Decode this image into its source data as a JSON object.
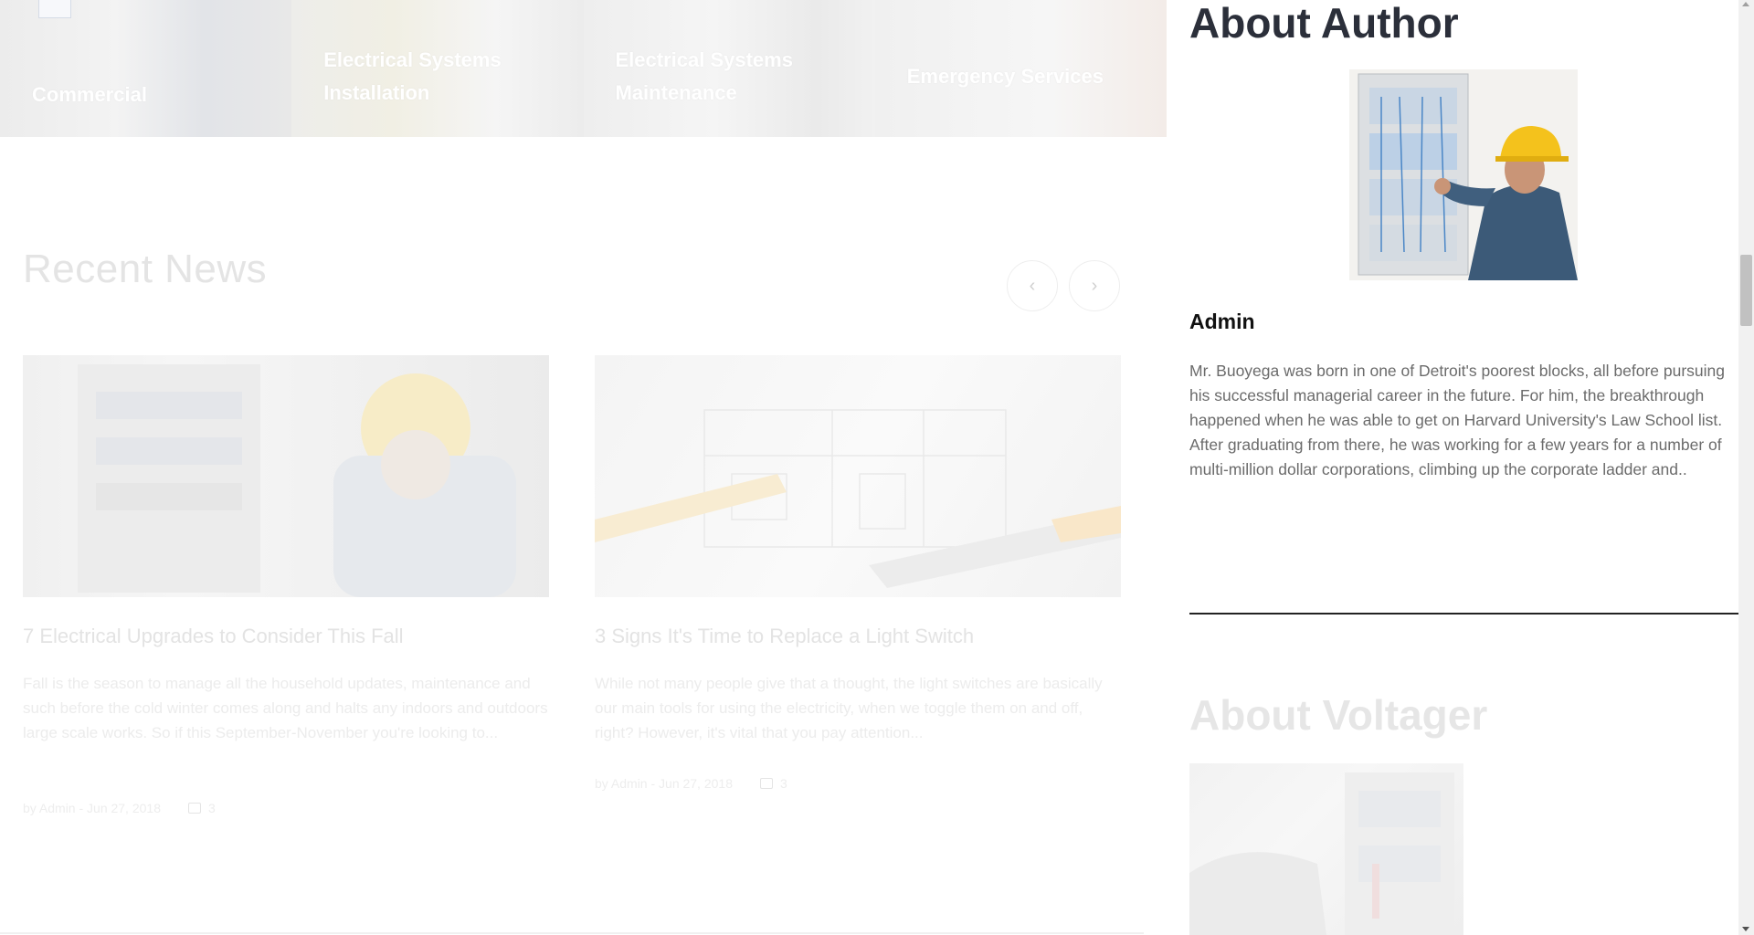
{
  "services": {
    "items": [
      {
        "label": "Commercial"
      },
      {
        "label": "Electrical Systems Installation"
      },
      {
        "label": "Electrical Systems Maintenance"
      },
      {
        "label": "Emergency Services"
      }
    ]
  },
  "news": {
    "title": "Recent News",
    "prev_icon": "chevron-left-icon",
    "next_icon": "chevron-right-icon",
    "posts": [
      {
        "title": "7 Electrical Upgrades to Consider This Fall",
        "excerpt": "Fall is the season to manage all the household updates, maintenance and such before the cold winter comes along and halts any indoors and outdoors large scale works. So if this September-November you're looking to...",
        "meta": "by Admin - Jun 27, 2018",
        "comments": "3"
      },
      {
        "title": "3 Signs It's Time to Replace a Light Switch",
        "excerpt": "While not many people give that a thought, the light switches are basically our main tools for using the electricity, when we toggle them on and off, right? However, it's vital that you pay attention...",
        "meta": "by Admin - Jun 27, 2018",
        "comments": "3"
      }
    ]
  },
  "sidebar": {
    "about_author_title": "About Author",
    "author_name": "Admin",
    "author_bio": "Mr. Buoyega was born in one of Detroit's poorest blocks, all before pursuing his successful managerial career in the future. For him, the breakthrough happened when he was able to get on Harvard University's Law School list. After graduating from there, he was working for a few years for a number of multi-million dollar corporations, climbing up the corporate ladder and..",
    "about_company_title": "About Voltager"
  },
  "colors": {
    "heading_dark": "#2b2f3a",
    "body_text": "#6b6b6b",
    "faded_text": "#e4e4e4",
    "helmet_yellow": "#f4c21c",
    "jacket_blue": "#3c5a78"
  }
}
